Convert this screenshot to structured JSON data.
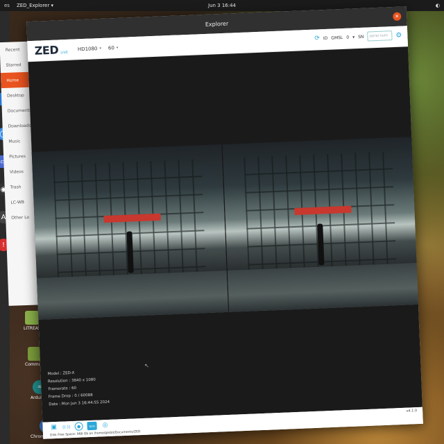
{
  "topbar": {
    "activities": "es",
    "app_menu": "ZED_Explorer ▾",
    "clock": "Jun 3  16:44",
    "tray": "◐"
  },
  "dock": {
    "items": [
      {
        "icon": "blue-app-icon",
        "glyph": "",
        "color": "#2a7ad8"
      },
      {
        "icon": "chromium-icon",
        "glyph": "◯",
        "color": "#3a8ee6"
      },
      {
        "icon": "screen-icon",
        "glyph": "▭",
        "color": "#4a6ad0"
      },
      {
        "icon": "obs-icon",
        "glyph": "◉",
        "color": "#333333"
      },
      {
        "icon": "anaconda-icon",
        "glyph": "A",
        "color": "#444444"
      },
      {
        "icon": "alert-icon",
        "glyph": "!",
        "color": "#d83030"
      }
    ]
  },
  "files": {
    "items": [
      "Recent",
      "Starred",
      "Home",
      "Desktop",
      "Documents",
      "Downloads",
      "Music",
      "Pictures",
      "Videos",
      "Trash",
      "LC-WB",
      "Other Lo"
    ],
    "active_index": 2
  },
  "desktop_icons": [
    {
      "label": "LITREAS",
      "color": "#8ab04a",
      "glyph": ""
    },
    {
      "label": "Communi",
      "color": "#7a9a3a",
      "glyph": ""
    },
    {
      "label": "Arduino I",
      "color": "#1e8a8a",
      "glyph": "∞"
    },
    {
      "label": "Chromium Web",
      "color": "#3a7ad8",
      "glyph": "◯"
    }
  ],
  "window": {
    "title": "Explorer",
    "close_glyph": "✕"
  },
  "toolbar": {
    "logo": "ZED",
    "live": "LIVE",
    "resolution": "HD1080",
    "fps": "60",
    "caret": "▾",
    "sync_glyph": "⟳",
    "id_label": "ID",
    "gmsl_label": "GMSL",
    "gmsl_value": "0",
    "sn_label": "SN",
    "serial_placeholder": "serial num",
    "settings_glyph": "⚙"
  },
  "info": {
    "model": "Model : ZED-X",
    "resolution": "Resolution : 3840 x 1080",
    "framerate": "Framerate : 60",
    "frame_drop": "Frame Drop : 0 / 60088",
    "date": "Date : Mon Jun 3 16:44:55 2024"
  },
  "bottombar": {
    "version": "v4.1.0",
    "status": "Disk Free Space: 968 Gb  on  /home/gedot/Documents/ZED",
    "icons": {
      "folder": "▣",
      "stream": "((·))",
      "record": "●",
      "svo": "SVO",
      "snapshot": "◎"
    }
  }
}
